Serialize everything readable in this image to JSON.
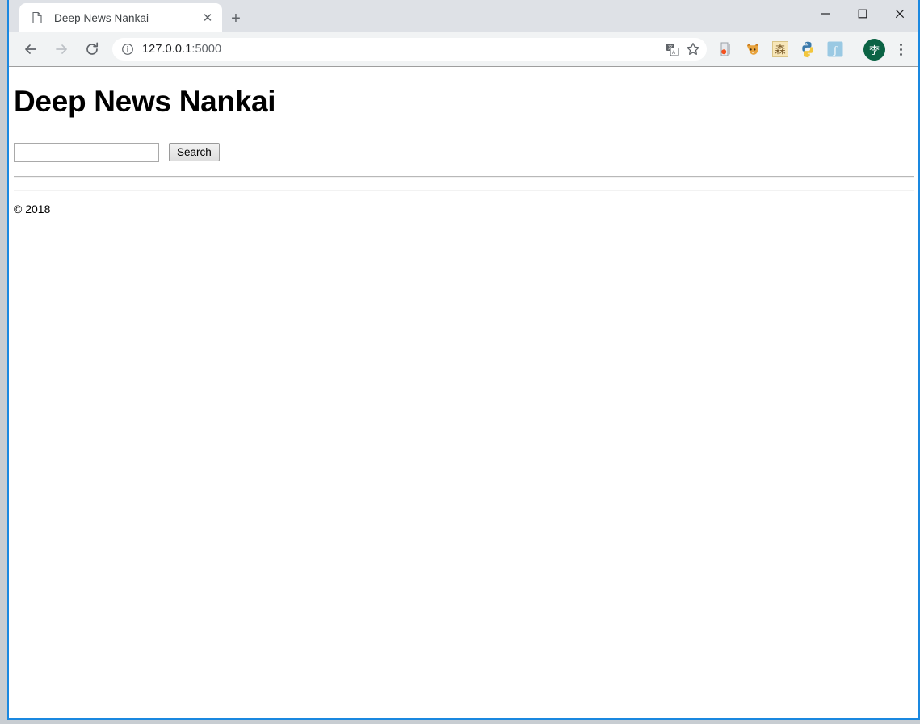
{
  "window": {
    "controls": {
      "minimize_label": "─",
      "maximize_label": "□",
      "close_label": "✕"
    }
  },
  "tabstrip": {
    "tabs": [
      {
        "title": "Deep News Nankai",
        "favicon": "page-icon",
        "close_label": "✕",
        "active": true
      }
    ],
    "new_tab_label": "+"
  },
  "toolbar": {
    "back_label": "←",
    "forward_label": "→",
    "reload_label": "C",
    "omnibox": {
      "info_icon": "site-information-icon",
      "url_host": "127.0.0.1",
      "url_port": ":5000",
      "translate_icon": "translate-icon",
      "bookmark_icon": "star-icon"
    },
    "extensions": [
      {
        "name": "extension-door-orange-dot",
        "glyph": ""
      },
      {
        "name": "extension-fox",
        "glyph": ""
      },
      {
        "name": "extension-tan-character",
        "glyph": "森"
      },
      {
        "name": "extension-python",
        "glyph": ""
      },
      {
        "name": "extension-blue-s",
        "glyph": "ʃ"
      }
    ],
    "profile": {
      "name": "profile-avatar",
      "initial": "李",
      "color": "#0b6344"
    },
    "menu_label": "chrome-menu"
  },
  "page": {
    "title": "Deep News Nankai",
    "search": {
      "value": "",
      "placeholder": "",
      "button_label": "Search"
    },
    "copyright": "© 2018"
  }
}
